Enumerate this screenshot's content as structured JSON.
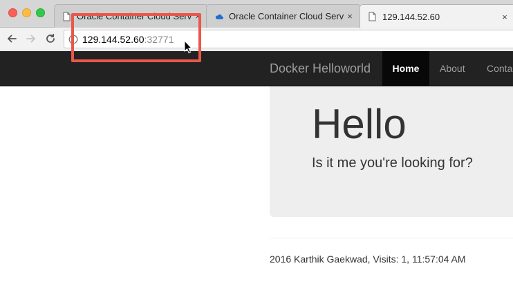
{
  "browser": {
    "tabs": [
      {
        "title": "Oracle Container Cloud Servi",
        "icon": "document-icon",
        "close": "×"
      },
      {
        "title": "Oracle Container Cloud Servic",
        "icon": "cloud-icon",
        "close": "×"
      },
      {
        "title": "129.144.52.60",
        "icon": "document-icon",
        "close": "×"
      }
    ],
    "address": {
      "host": "129.144.52.60",
      "port": ":32771"
    }
  },
  "site": {
    "brand": "Docker Helloworld",
    "nav": {
      "home": "Home",
      "about": "About",
      "contact": "Conta"
    },
    "jumbotron": {
      "heading": "Hello",
      "subheading": "Is it me you're looking for?"
    },
    "footer": "2016 Karthik Gaekwad, Visits: 1,  11:57:04 AM"
  },
  "colors": {
    "highlight": "#e9574a",
    "navbar": "#222222",
    "jumbotron": "#eeeeee",
    "cloud_icon": "#1f6fd1"
  }
}
